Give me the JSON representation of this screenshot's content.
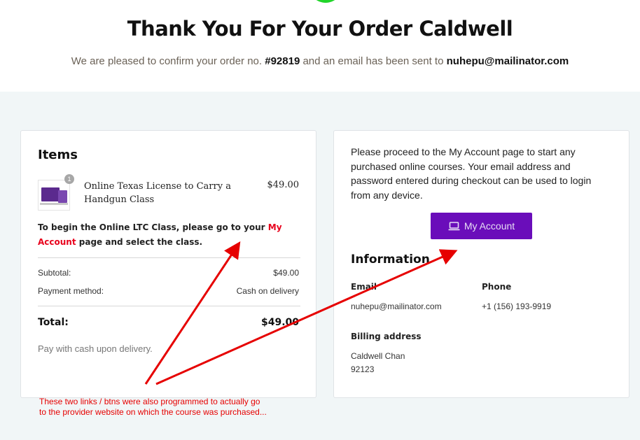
{
  "header": {
    "title": "Thank You For Your Order Caldwell",
    "confirm_prefix": "We are pleased to confirm your order no.",
    "order_no": "#92819",
    "confirm_middle": "and an email has been sent to",
    "email": "nuhepu@mailinator.com"
  },
  "items_card": {
    "heading": "Items",
    "item": {
      "name": "Online Texas License to Carry a Handgun Class",
      "price": "$49.00",
      "quantity": "1"
    },
    "ltc_note_prefix": "To begin the Online LTC Class, please go to your",
    "ltc_note_link": "My Account",
    "ltc_note_suffix": "page and select the class.",
    "subtotal_label": "Subtotal:",
    "subtotal_value": "$49.00",
    "payment_label": "Payment method:",
    "payment_value": "Cash on delivery",
    "total_label": "Total:",
    "total_value": "$49.00",
    "pay_note": "Pay with cash upon delivery."
  },
  "account_card": {
    "proceed_text": "Please proceed to the My Account page to start any purchased online courses. Your email address and password entered during checkout can be used to login from any device.",
    "button_label": "My Account",
    "button_icon": "laptop-icon",
    "info_heading": "Information",
    "email_label": "Email",
    "email_value": "nuhepu@mailinator.com",
    "phone_label": "Phone",
    "phone_value": "+1 (156) 193-9919",
    "billing_label": "Billing address",
    "billing_name": "Caldwell Chan",
    "billing_zip": "92123"
  },
  "annotation": {
    "line1": "These two links / btns were also programmed to actually go",
    "line2": "to the provider website on which the course was purchased..."
  },
  "colors": {
    "accent_purple": "#6a0dba",
    "link_red": "#e8001c",
    "annotation_red": "#e60000",
    "success_green": "#21d52a",
    "background": "#f1f6f7"
  }
}
